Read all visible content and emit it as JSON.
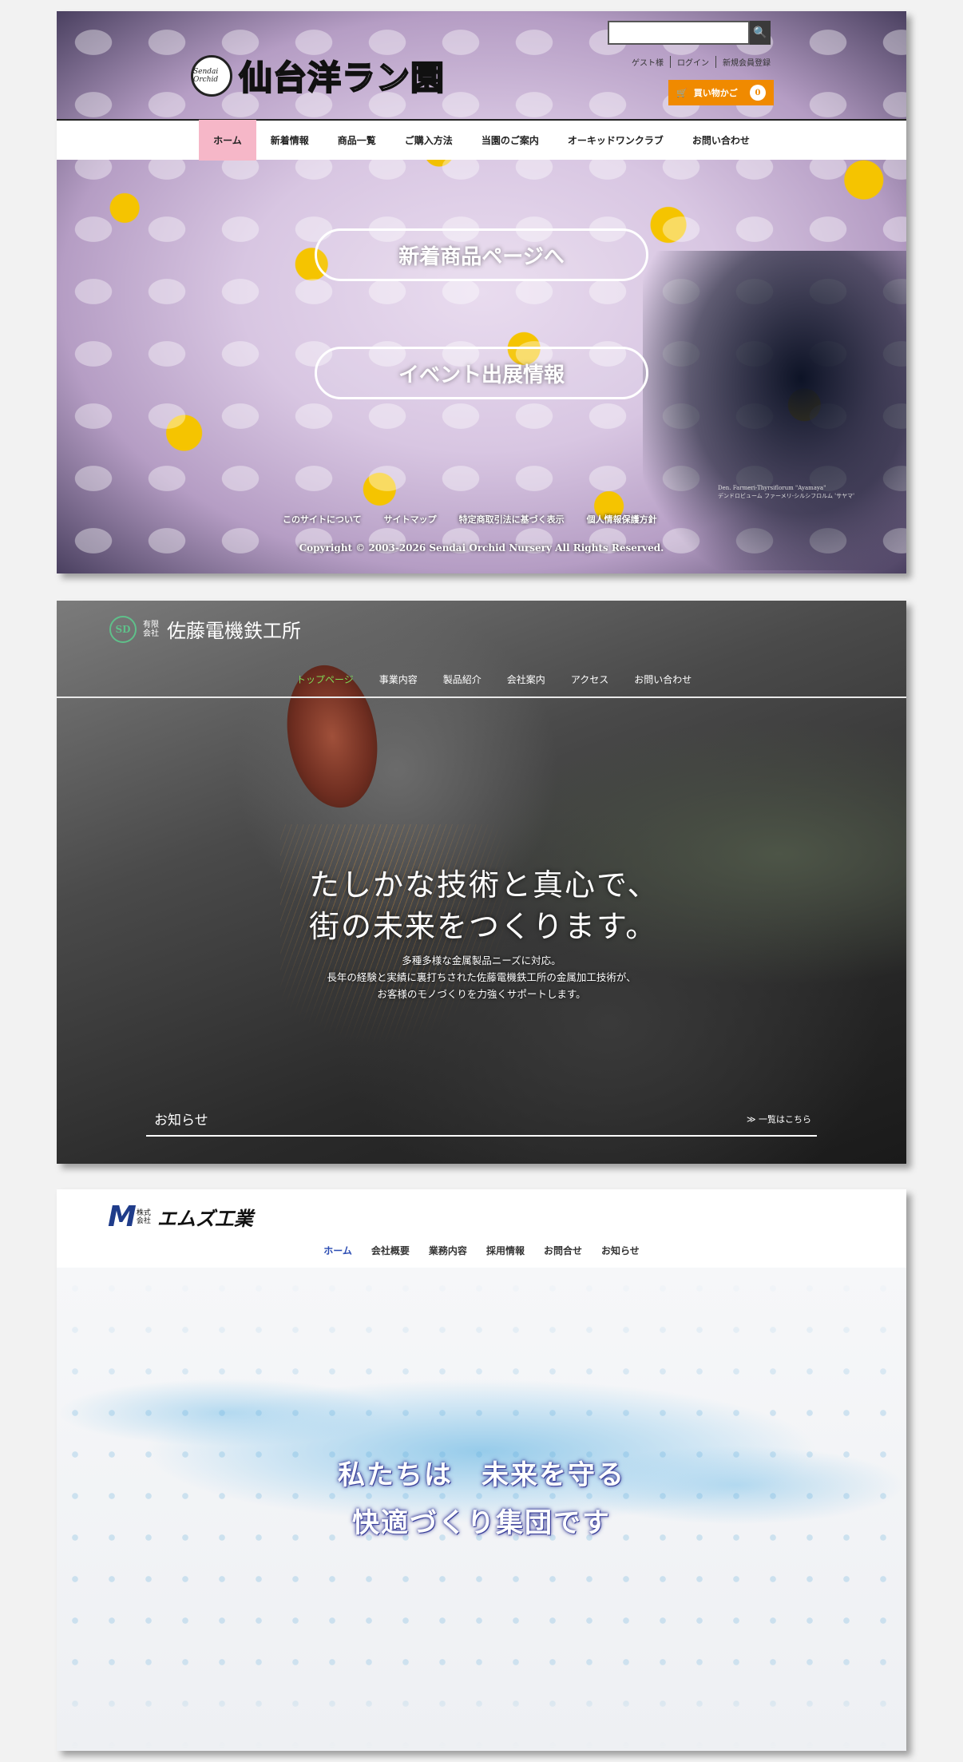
{
  "orchid": {
    "logo_mark": "Sendai Orchid",
    "logo_text": "仙台洋ラン園",
    "search": {
      "placeholder": "",
      "button_icon": "🔍"
    },
    "account": {
      "guest": "ゲスト様",
      "login": "ログイン",
      "register": "新規会員登録"
    },
    "cart": {
      "label": "買い物かご",
      "count": "0"
    },
    "nav": [
      "ホーム",
      "新着情報",
      "商品一覧",
      "ご購入方法",
      "当園のご案内",
      "オーキッドワンクラブ",
      "お問い合わせ"
    ],
    "hero_buttons": [
      "新着商品ページへ",
      "イベント出展情報"
    ],
    "caption_line1": "Den. Farmeri-Thyrsiflorum \"Ayamaya\"",
    "caption_line2": "デンドロビューム ファーメリ-シルシフロルム 'サヤマ'",
    "footer_links": [
      "このサイトについて",
      "サイトマップ",
      "特定商取引法に基づく表示",
      "個人情報保護方針"
    ],
    "copyright": "Copyright © 2003-2026 Sendai Orchid Nursery All Rights Reserved."
  },
  "sato": {
    "logo_mark": "SD",
    "logo_prefix": "有限会社",
    "logo_name": "佐藤電機鉄工所",
    "nav": [
      "トップページ",
      "事業内容",
      "製品紹介",
      "会社案内",
      "アクセス",
      "お問い合わせ"
    ],
    "headline_line1": "たしかな技術と真心で、",
    "headline_line2": "街の未来をつくります。",
    "sub_line1": "多種多様な金属製品ニーズに対応。",
    "sub_line2": "長年の経験と実績に裏打ちされた佐藤電機鉄工所の金属加工技術が、",
    "sub_line3": "お客様のモノづくりを力強くサポートします。",
    "news_label": "お知らせ",
    "news_more": "≫ 一覧はこちら"
  },
  "ms": {
    "logo_mark": "M",
    "logo_prefix": "株式会社",
    "logo_name": "エムズ工業",
    "nav": [
      "ホーム",
      "会社概要",
      "業務内容",
      "採用情報",
      "お問合せ",
      "お知らせ"
    ],
    "headline_line1": "私たちは　未来を守る",
    "headline_line2": "快適づくり集団です"
  },
  "colors": {
    "orchid_cart": "#f08a00",
    "orchid_nav_active": "#f6b7c8",
    "sato_nav_active": "#7ed957",
    "ms_nav_active": "#2b4cb3",
    "ms_logo": "#1f3c8a"
  }
}
